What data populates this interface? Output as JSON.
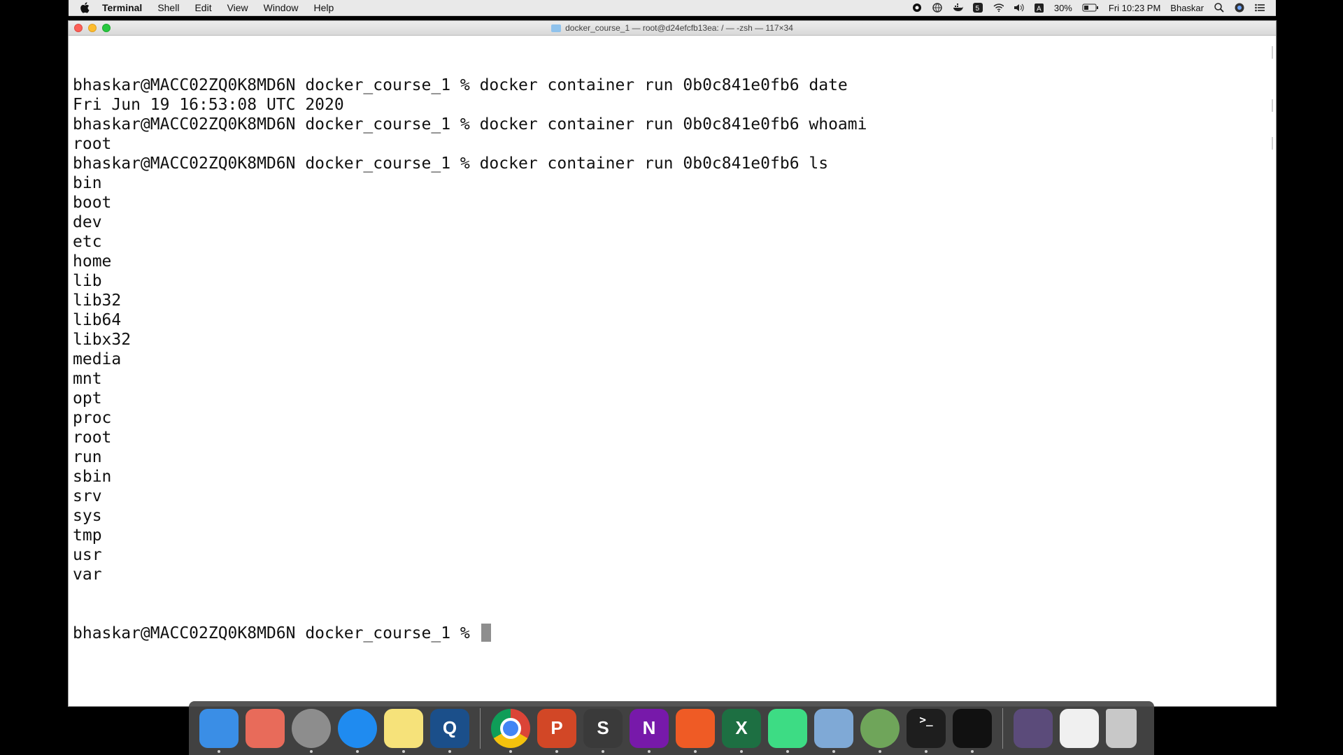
{
  "menubar": {
    "app_name": "Terminal",
    "items": [
      "Shell",
      "Edit",
      "View",
      "Window",
      "Help"
    ],
    "battery": "30%",
    "clock": "Fri 10:23 PM",
    "user": "Bhaskar"
  },
  "window": {
    "title": "docker_course_1 — root@d24efcfb13ea: / — -zsh — 117×34"
  },
  "terminal": {
    "lines": [
      "bhaskar@MACC02ZQ0K8MD6N docker_course_1 % docker container run 0b0c841e0fb6 date",
      "Fri Jun 19 16:53:08 UTC 2020",
      "bhaskar@MACC02ZQ0K8MD6N docker_course_1 % docker container run 0b0c841e0fb6 whoami",
      "root",
      "bhaskar@MACC02ZQ0K8MD6N docker_course_1 % docker container run 0b0c841e0fb6 ls",
      "bin",
      "boot",
      "dev",
      "etc",
      "home",
      "lib",
      "lib32",
      "lib64",
      "libx32",
      "media",
      "mnt",
      "opt",
      "proc",
      "root",
      "run",
      "sbin",
      "srv",
      "sys",
      "tmp",
      "usr",
      "var"
    ],
    "prompt": "bhaskar@MACC02ZQ0K8MD6N docker_course_1 % "
  },
  "dock": {
    "apps": [
      {
        "name": "finder",
        "label": "",
        "color": "#3a8ee6"
      },
      {
        "name": "launchpad",
        "label": "",
        "color": "#e86b5a"
      },
      {
        "name": "rocket",
        "label": "",
        "color": "#8d8d8d"
      },
      {
        "name": "safari",
        "label": "",
        "color": "#1f8bf0"
      },
      {
        "name": "notes",
        "label": "",
        "color": "#f6e27a"
      },
      {
        "name": "quicktime",
        "label": "Q",
        "color": "#1b4f8a"
      },
      {
        "name": "chrome",
        "label": "",
        "color": "#e9e9e9"
      },
      {
        "name": "powerpoint",
        "label": "P",
        "color": "#d24726"
      },
      {
        "name": "sublime",
        "label": "S",
        "color": "#3a3a3a"
      },
      {
        "name": "onenote",
        "label": "N",
        "color": "#7719aa"
      },
      {
        "name": "postman",
        "label": "",
        "color": "#ef5b25"
      },
      {
        "name": "excel",
        "label": "X",
        "color": "#1d6f42"
      },
      {
        "name": "android-studio",
        "label": "",
        "color": "#3ddc84"
      },
      {
        "name": "virtualbox",
        "label": "",
        "color": "#7fa9d6"
      },
      {
        "name": "globe-app",
        "label": "",
        "color": "#6fa55a"
      },
      {
        "name": "terminal",
        "label": ">_",
        "color": "#1e1e1e"
      },
      {
        "name": "console",
        "label": "",
        "color": "#111111"
      },
      {
        "name": "printer",
        "label": "",
        "color": "#5b4b7a"
      },
      {
        "name": "preview",
        "label": "",
        "color": "#f0f0f0"
      },
      {
        "name": "trash",
        "label": "",
        "color": "#c8c8c8"
      }
    ]
  }
}
